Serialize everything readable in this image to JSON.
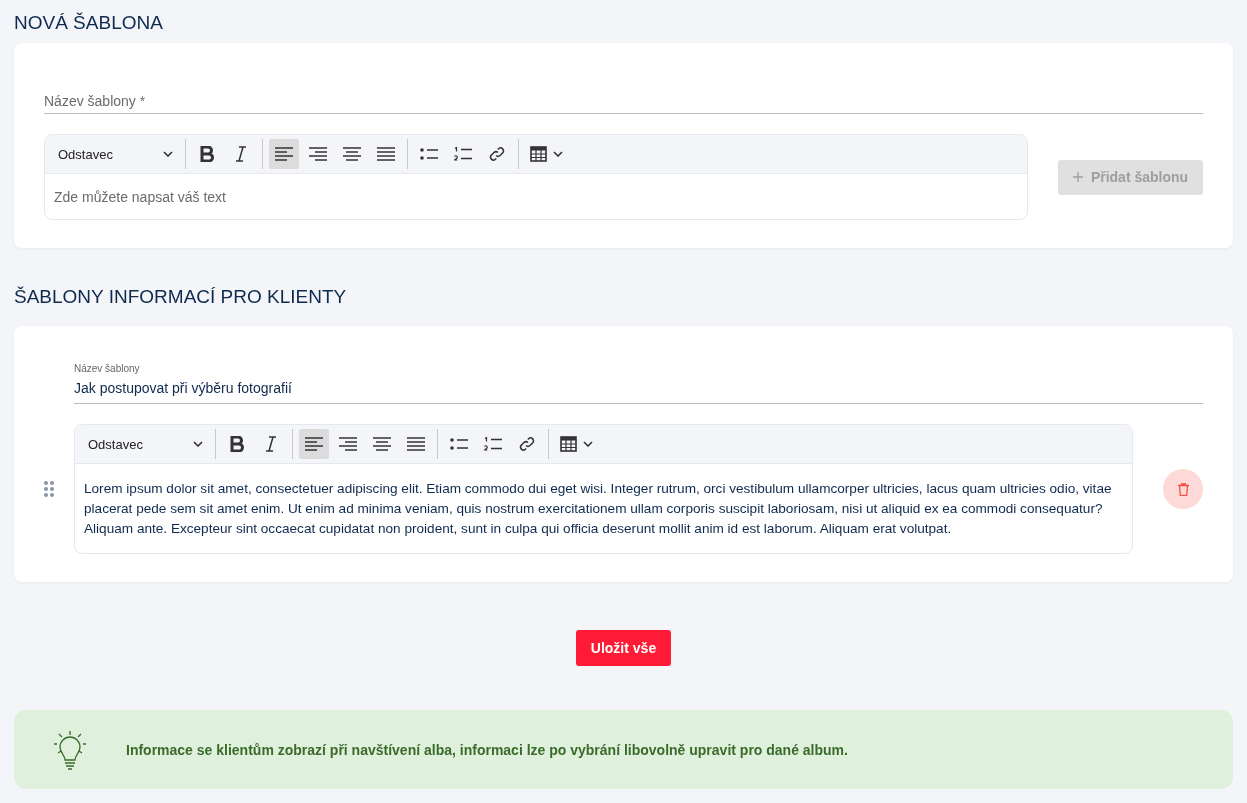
{
  "new_template": {
    "heading": "NOVÁ ŠABLONA",
    "name_field": {
      "placeholder": "Název šablony *"
    },
    "editor": {
      "format": "Odstavec",
      "tool_groups": [
        [
          {
            "kind": "bold",
            "selected": false
          },
          {
            "kind": "italic",
            "selected": false
          }
        ],
        [
          {
            "kind": "align-left",
            "selected": true
          },
          {
            "kind": "align-right",
            "selected": false
          },
          {
            "kind": "align-center",
            "selected": false
          },
          {
            "kind": "justify",
            "selected": false
          }
        ],
        [
          {
            "kind": "bullet-list",
            "selected": false
          },
          {
            "kind": "numbered-list",
            "selected": false
          },
          {
            "kind": "link",
            "selected": false
          }
        ],
        [
          {
            "kind": "table",
            "selected": false
          }
        ]
      ],
      "placeholder": "Zde můžete napsat váš text"
    },
    "add_button": {
      "label": "Přidat šablonu",
      "disabled": true
    }
  },
  "templates_section": {
    "heading": "ŠABLONY INFORMACÍ PRO KLIENTY",
    "templates": [
      {
        "name_label": "Název šablony",
        "name": "Jak postupovat při výběru fotografií",
        "editor": {
          "format": "Odstavec",
          "tool_groups": [
            [
              {
                "kind": "bold",
                "selected": false
              },
              {
                "kind": "italic",
                "selected": false
              }
            ],
            [
              {
                "kind": "align-left",
                "selected": true
              },
              {
                "kind": "align-right",
                "selected": false
              },
              {
                "kind": "align-center",
                "selected": false
              },
              {
                "kind": "justify",
                "selected": false
              }
            ],
            [
              {
                "kind": "bullet-list",
                "selected": false
              },
              {
                "kind": "numbered-list",
                "selected": false
              },
              {
                "kind": "link",
                "selected": false
              }
            ],
            [
              {
                "kind": "table",
                "selected": false
              }
            ]
          ],
          "text": "Lorem ipsum dolor sit amet, consectetuer adipiscing elit. Etiam commodo dui eget wisi. Integer rutrum, orci vestibulum ullamcorper ultricies, lacus quam ultricies odio, vitae placerat pede sem sit amet enim. Ut enim ad minima veniam, quis nostrum exercitationem ullam corporis suscipit laboriosam, nisi ut aliquid ex ea commodi consequatur? Aliquam ante. Excepteur sint occaecat cupidatat non proident, sunt in culpa qui officia deserunt mollit anim id est laborum. Aliquam erat volutpat."
        }
      }
    ]
  },
  "save_button": "Uložit vše",
  "info": "Informace se klientům zobrazí při navštívení alba, informaci lze po vybrání libovolně upravit pro dané album."
}
